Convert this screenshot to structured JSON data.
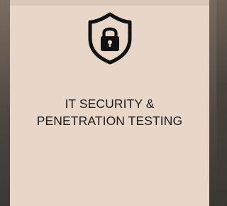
{
  "card": {
    "icon": "shield-lock-icon",
    "title_line1": "IT SECURITY &",
    "title_line2": "PENETRATION TESTING",
    "colors": {
      "card_background": "#e8d7c8",
      "text": "#1b1b1b",
      "icon": "#111111",
      "page_background": "#4a433d"
    }
  }
}
